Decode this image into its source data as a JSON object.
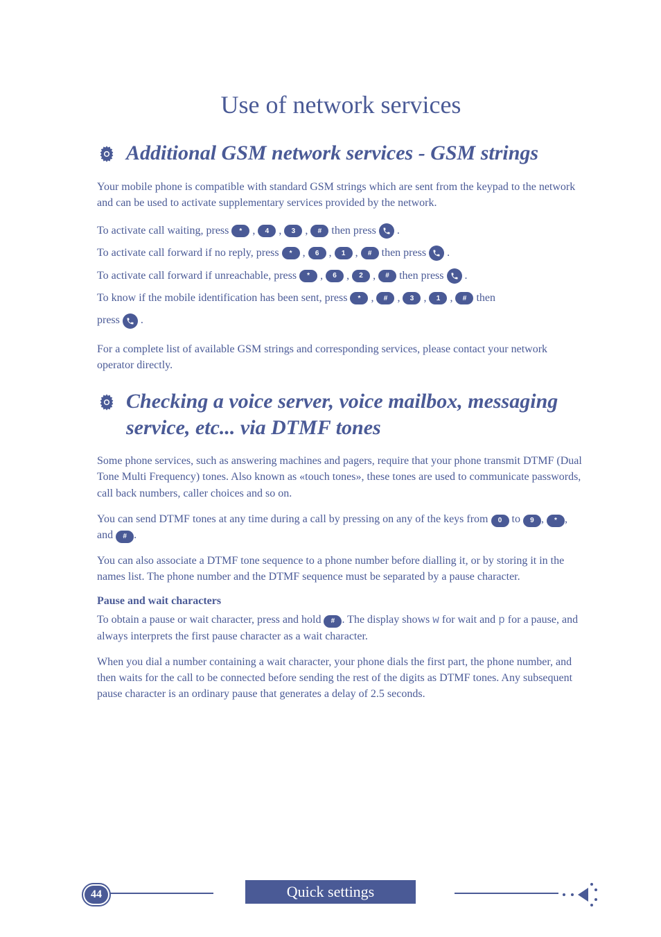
{
  "title": "Use of network services",
  "section1": {
    "heading": "Additional GSM network services - GSM strings",
    "intro": "Your mobile phone is compatible with standard GSM strings which are sent from the keypad to the network and can be used to activate supplementary services provided by the network.",
    "lines": [
      {
        "prefix": "To activate call waiting, press ",
        "keys": [
          "*",
          "4",
          "3",
          "#"
        ],
        "mid": " then press ",
        "end_key": "📞",
        "suffix": "."
      },
      {
        "prefix": "To activate call forward if no reply, press ",
        "keys": [
          "*",
          "6",
          "1",
          "#"
        ],
        "mid": " then press ",
        "end_key": "📞",
        "suffix": "."
      },
      {
        "prefix": "To activate call forward if unreachable, press ",
        "keys": [
          "*",
          "6",
          "2",
          "#"
        ],
        "mid": " then press ",
        "end_key": "📞",
        "suffix": "."
      },
      {
        "prefix": "To know if the mobile identification has been sent, press ",
        "keys": [
          "*",
          "#",
          "3",
          "1",
          "#"
        ],
        "mid": " then press ",
        "end_key": "📞",
        "suffix": "."
      }
    ],
    "outro": "For a complete list of available GSM strings and corresponding services, please contact your network operator directly."
  },
  "section2": {
    "heading": "Checking a voice server, voice mailbox, messaging service, etc... via DTMF tones",
    "p1": "Some phone services, such as answering machines and pagers, require that your phone transmit DTMF (Dual Tone Multi Frequency) tones.  Also known as «touch tones», these tones are used to communicate passwords, call back numbers, caller choices and so on.",
    "p2_pre": "You can send DTMF tones at any time during a call by pressing on any of the keys from ",
    "p2_key_from": "0",
    "p2_to": " to ",
    "p2_key_to": "9",
    "p2_comma": ", ",
    "p2_key_star": "*",
    "p2_and": ", and ",
    "p2_key_hash": "#",
    "p2_end": ".",
    "p3": "You can also associate a DTMF tone sequence to a phone number before dialling it, or by storing it in the names list.  The phone number and the DTMF sequence must be separated by a pause character.",
    "sub_heading": "Pause and wait characters",
    "p4_pre": "To obtain a pause or wait character, press and hold ",
    "p4_key": "#",
    "p4_mid1": ".  The display shows ",
    "p4_w": "w",
    "p4_mid2": " for wait and ",
    "p4_p": "p",
    "p4_end": " for a pause, and always interprets the first pause character as a wait character.",
    "p5": "When you dial a number containing a wait character, your phone dials the first part, the phone number, and then waits for the call to be connected before sending the rest of the digits as DTMF tones.  Any subsequent pause character is an ordinary pause that generates a delay of 2.5 seconds."
  },
  "footer": {
    "page": "44",
    "label": "Quick settings"
  }
}
